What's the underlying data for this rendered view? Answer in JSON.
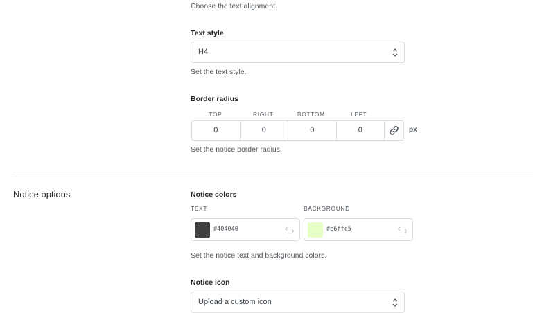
{
  "alignment": {
    "help": "Choose the text alignment."
  },
  "text_style": {
    "label": "Text style",
    "value": "H4",
    "help": "Set the text style."
  },
  "border_radius": {
    "label": "Border radius",
    "sides": [
      {
        "label": "TOP",
        "value": "0"
      },
      {
        "label": "RIGHT",
        "value": "0"
      },
      {
        "label": "BOTTOM",
        "value": "0"
      },
      {
        "label": "LEFT",
        "value": "0"
      }
    ],
    "unit": "px",
    "help": "Set the notice border radius."
  },
  "notice_options": {
    "section_title": "Notice options",
    "colors": {
      "label": "Notice colors",
      "text_label": "TEXT",
      "text_value": "#404040",
      "background_label": "BACKGROUND",
      "background_value": "#e6ffc5",
      "help": "Set the notice text and background colors."
    },
    "icon": {
      "label": "Notice icon",
      "value": "Upload a custom icon"
    }
  },
  "colors": {
    "text_swatch": "#404040",
    "background_swatch": "#e6ffc5",
    "border": "#dcdcde",
    "icon_gray": "#50575e"
  },
  "icons": {
    "select_chevron": "chevron-up-down-icon",
    "link": "link-icon",
    "reset": "undo-icon"
  }
}
